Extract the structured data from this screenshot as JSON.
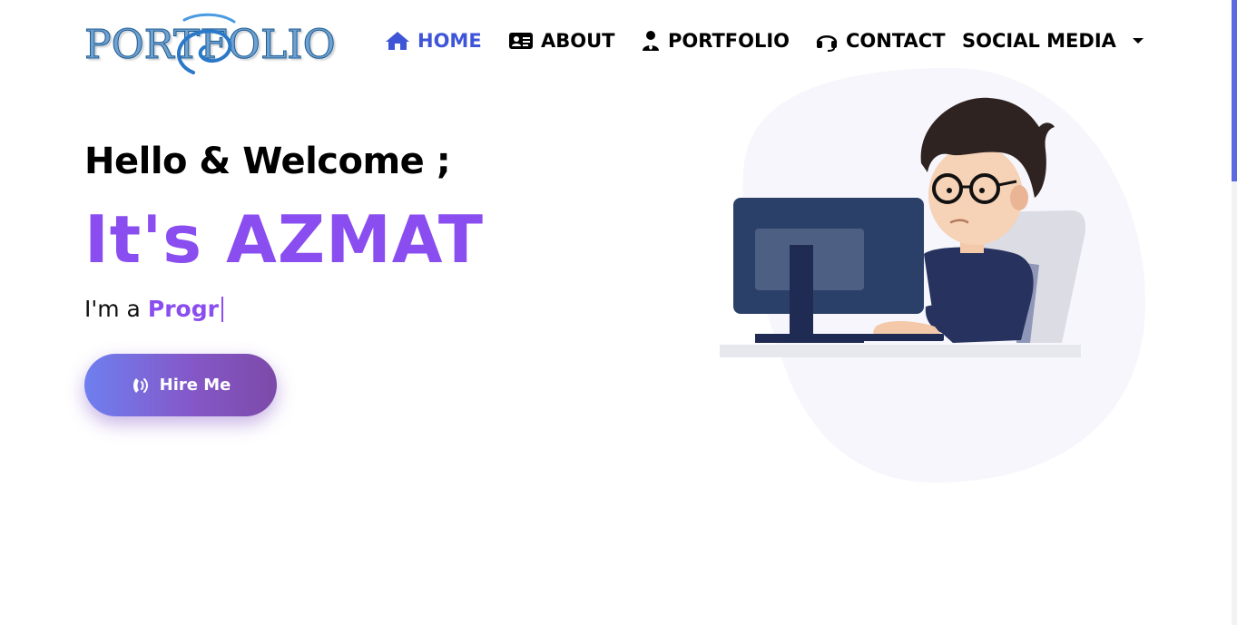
{
  "navbar": {
    "logo_text": "PORTFOLIO",
    "items": [
      {
        "label": "HOME",
        "icon": "home-icon",
        "active": true
      },
      {
        "label": "ABOUT",
        "icon": "id-card-icon",
        "active": false
      },
      {
        "label": "PORTFOLIO",
        "icon": "user-tie-icon",
        "active": false
      },
      {
        "label": "CONTACT",
        "icon": "headset-icon",
        "active": false
      },
      {
        "label": "SOCIAL MEDIA",
        "icon": "chevron-down-icon",
        "active": false
      }
    ]
  },
  "hero": {
    "greeting": "Hello & Welcome ;",
    "name": "It's AZMAT",
    "role_prefix": "I'm a",
    "role_typed": "Progr",
    "hire_button": {
      "label": "Hire Me",
      "icon": "phone-volume-icon"
    }
  },
  "colors": {
    "accent": "#8a4df0",
    "nav_active": "#3f55d8",
    "button_gradient_start": "#6f7ff0",
    "button_gradient_end": "#7c4aa8"
  }
}
